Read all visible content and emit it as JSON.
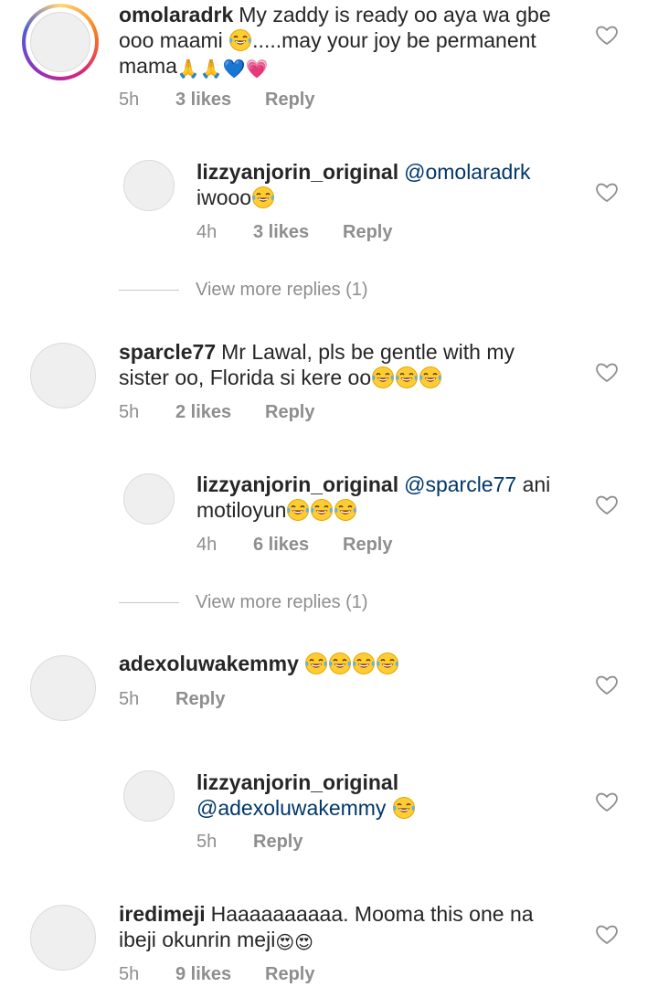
{
  "comments": [
    {
      "username": "omolaradrk",
      "text_parts": [
        "My zaddy is ready oo aya wa gbe ooo maami ",
        "laugh",
        ".....may your joy be permanent mama",
        "🙏🙏💙💗"
      ],
      "time": "5h",
      "likes": "3 likes",
      "reply_label": "Reply",
      "has_story": true
    },
    {
      "username": "lizzyanjorin_original",
      "mention": "@omolaradrk",
      "text": "iwooo",
      "laughs": 1,
      "time": "4h",
      "likes": "3 likes",
      "reply_label": "Reply"
    },
    {
      "view_more": "View more replies (1)"
    },
    {
      "username": "sparcle77",
      "text": "Mr Lawal, pls be gentle with my sister oo, Florida si kere oo",
      "laughs": 3,
      "time": "5h",
      "likes": "2 likes",
      "reply_label": "Reply"
    },
    {
      "username": "lizzyanjorin_original",
      "mention": "@sparcle77",
      "text": "ani motiloyun",
      "laughs": 3,
      "time": "4h",
      "likes": "6 likes",
      "reply_label": "Reply"
    },
    {
      "view_more": "View more replies (1)"
    },
    {
      "username": "adexoluwakemmy",
      "text": "",
      "laughs": 4,
      "time": "5h",
      "reply_label": "Reply"
    },
    {
      "username": "lizzyanjorin_original",
      "mention": "@adexoluwakemmy",
      "laughs": 1,
      "time": "5h",
      "reply_label": "Reply"
    },
    {
      "username": "iredimeji",
      "text": "Haaaaaaaaaa. Mooma this one na ibeji okunrin meji",
      "emoji_tail": "😍😍",
      "time": "5h",
      "likes": "9 likes",
      "reply_label": "Reply"
    }
  ],
  "colors": {
    "text": "#262626",
    "meta": "#8e8e8e",
    "mention": "#00376b"
  },
  "icons": {
    "like": "heart-outline-icon",
    "laugh": "face-with-tears-of-joy-icon"
  }
}
